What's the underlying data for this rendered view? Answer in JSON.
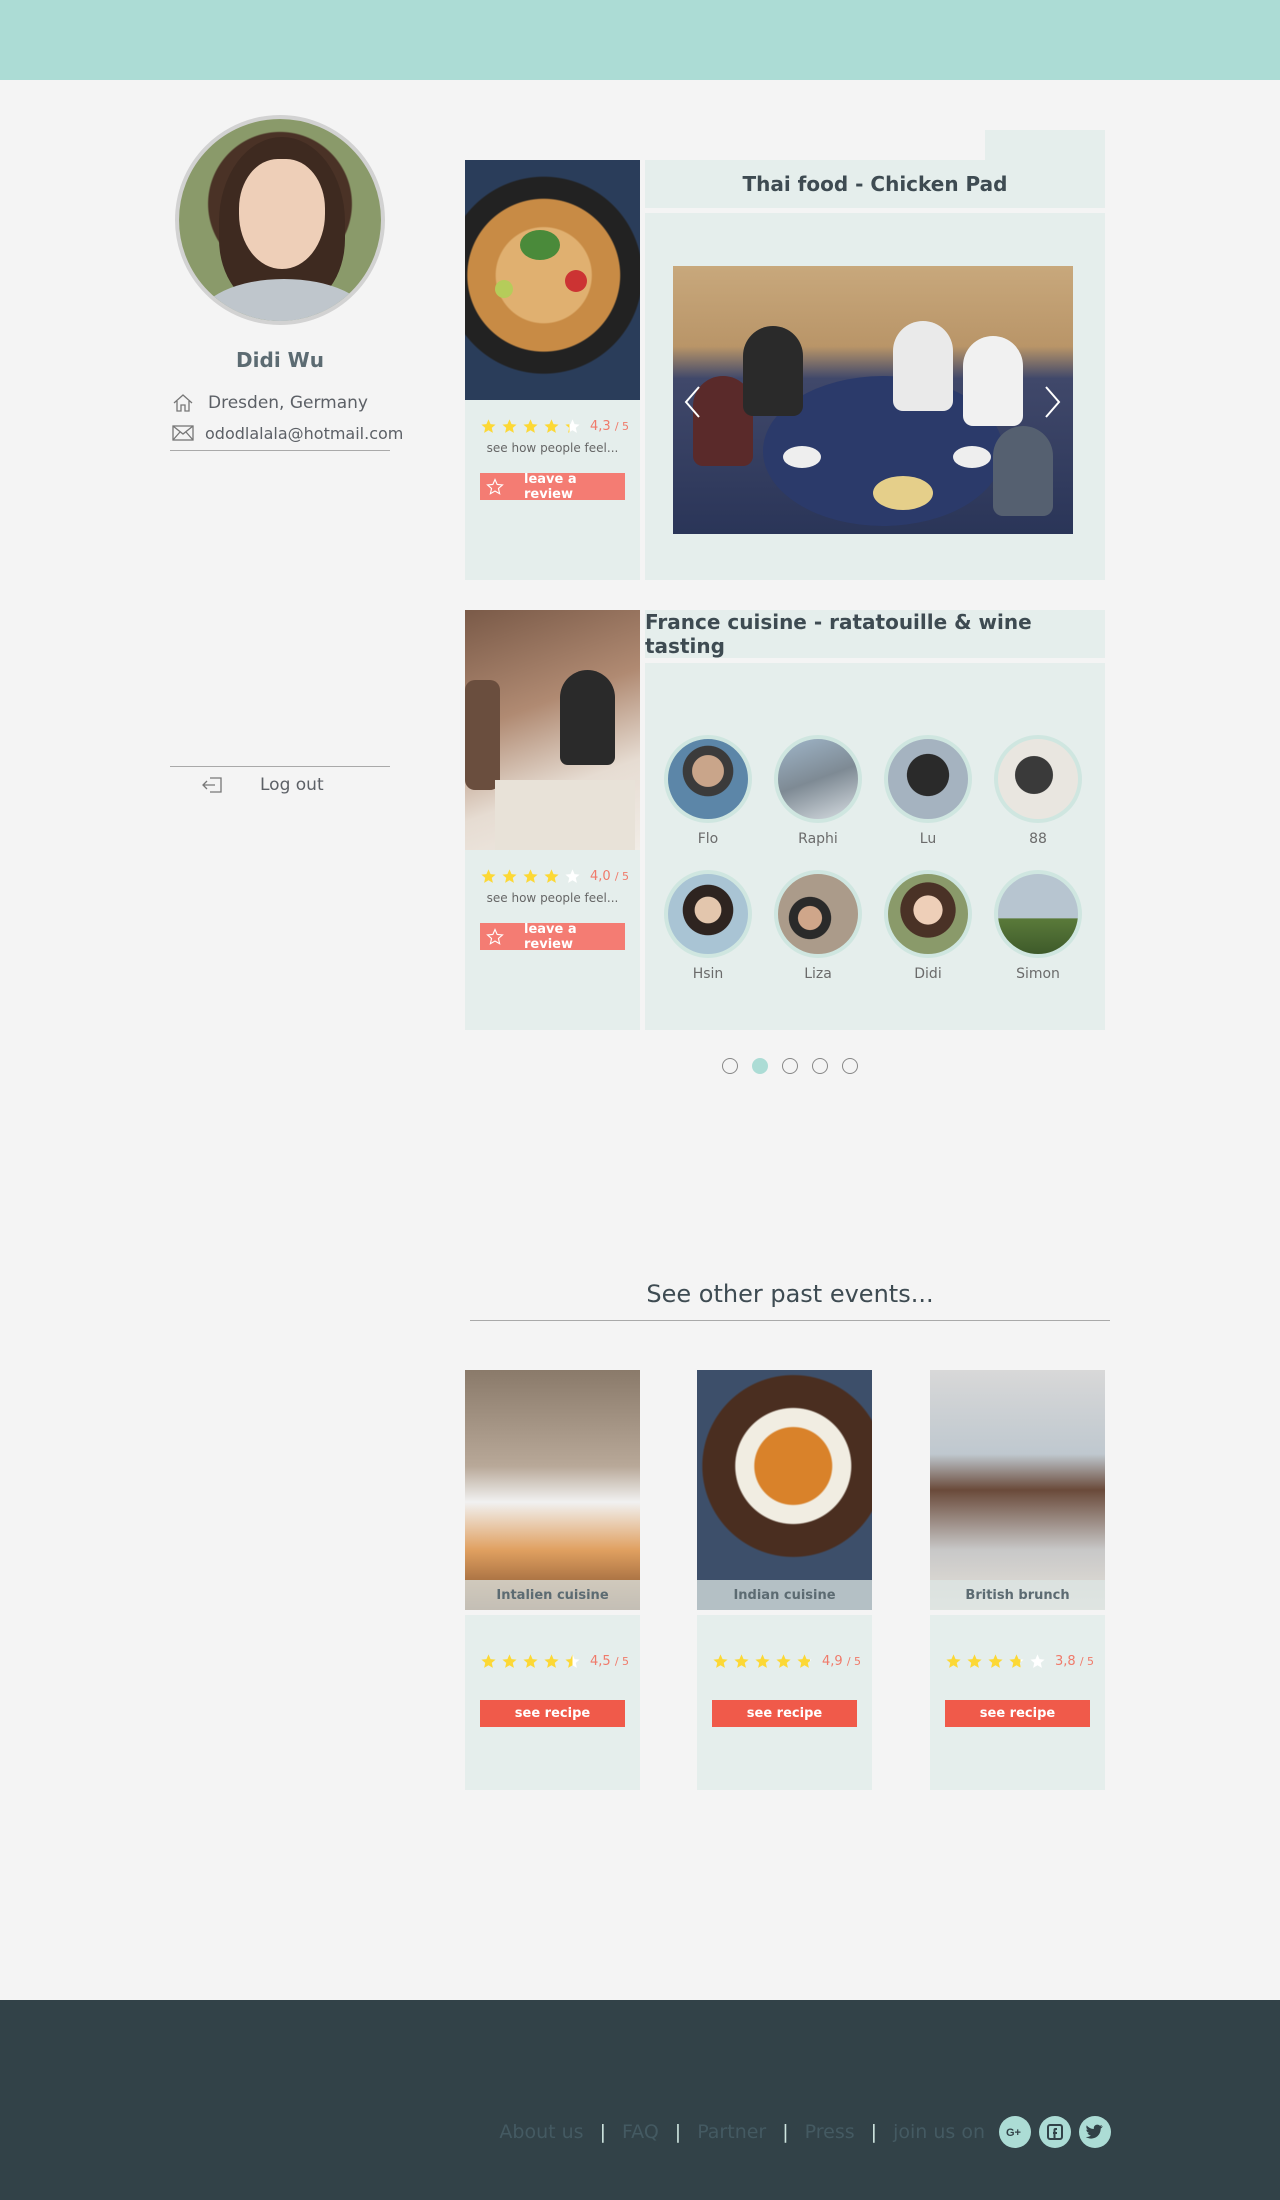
{
  "profile": {
    "name": "Didi Wu",
    "city": "Dresden, Germany",
    "email": "ododlalala@hotmail.com",
    "logout_label": "Log out"
  },
  "events": [
    {
      "title": "Thai food - Chicken Pad",
      "rating": 4.3,
      "rating_text": "4,3",
      "rating_max": "/ 5",
      "feel_text": "see how people feel...",
      "review_label": "leave a review"
    },
    {
      "title": "France cuisine - ratatouille & wine tasting",
      "rating": 4.0,
      "rating_text": "4,0",
      "rating_max": "/ 5",
      "feel_text": "see how people feel...",
      "review_label": "leave a review",
      "members": [
        "Flo",
        "Raphi",
        "Lu",
        "88",
        "Hsin",
        "Liza",
        "Didi",
        "Simon"
      ]
    }
  ],
  "carousel": {
    "dot_count": 5,
    "active_index": 1
  },
  "past": {
    "heading": "See other past events...",
    "items": [
      {
        "caption": "Intalien cuisine",
        "rating": 4.5,
        "rating_text": "4,5",
        "rating_max": "/ 5",
        "button": "see recipe"
      },
      {
        "caption": "Indian cuisine",
        "rating": 4.9,
        "rating_text": "4,9",
        "rating_max": "/ 5",
        "button": "see recipe"
      },
      {
        "caption": "British brunch",
        "rating": 3.8,
        "rating_text": "3,8",
        "rating_max": "/ 5",
        "button": "see recipe"
      }
    ]
  },
  "footer": {
    "links": [
      "About us",
      "FAQ",
      "Partner",
      "Press",
      "join us on"
    ],
    "social_icons": [
      "google-plus-icon",
      "facebook-icon",
      "twitter-icon"
    ]
  },
  "colors": {
    "accent": "#acdcd5",
    "card_bg": "#e5eeec",
    "star": "#fcd835",
    "review_button": "#f47c73",
    "recipe_button": "#f05a4a",
    "footer_bg": "#324248"
  }
}
